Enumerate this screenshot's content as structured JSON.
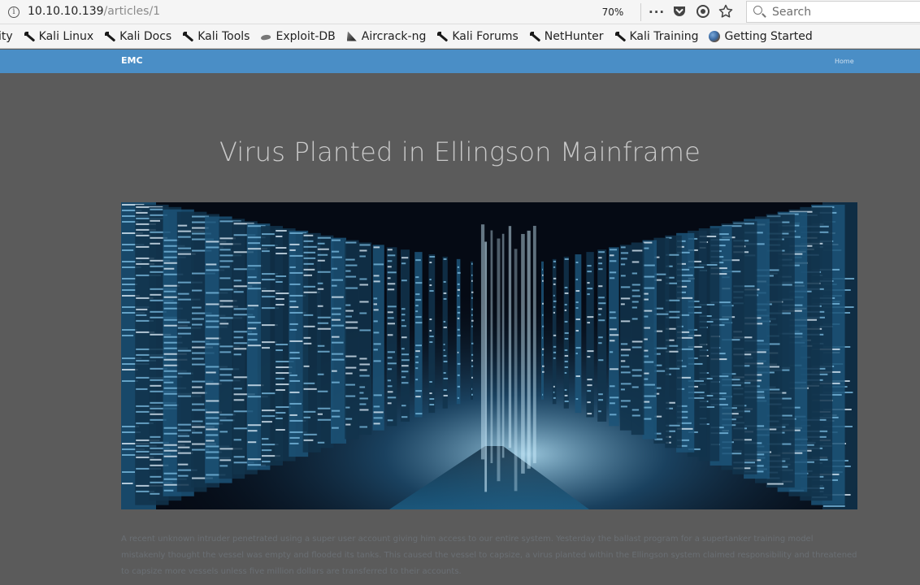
{
  "browser": {
    "url_host": "10.10.10.139",
    "url_path": "/articles/1",
    "zoom": "70%",
    "search_placeholder": "Search",
    "bookmarks": [
      {
        "label": "ity",
        "icon": "none"
      },
      {
        "label": "Kali Linux",
        "icon": "kali-dragon-icon"
      },
      {
        "label": "Kali Docs",
        "icon": "kali-dragon-icon"
      },
      {
        "label": "Kali Tools",
        "icon": "kali-dragon-icon"
      },
      {
        "label": "Exploit-DB",
        "icon": "exploit-db-icon"
      },
      {
        "label": "Aircrack-ng",
        "icon": "aircrack-icon"
      },
      {
        "label": "Kali Forums",
        "icon": "kali-dragon-icon"
      },
      {
        "label": "NetHunter",
        "icon": "kali-dragon-icon"
      },
      {
        "label": "Kali Training",
        "icon": "kali-dragon-icon"
      },
      {
        "label": "Getting Started",
        "icon": "globe-icon"
      }
    ]
  },
  "navbar": {
    "brand": "EMC",
    "home_link": "Home",
    "color": "#4a8ec6"
  },
  "article": {
    "title": "Virus Planted in Ellingson Mainframe",
    "hero_image": "server-corridor-data-image",
    "body": "A recent unknown intruder penetrated using a super user account giving him access to our entire system. Yesterday the ballast program for a supertanker training model mistakenly thought the vessel was empty and flooded its tanks. This caused the vessel to capsize, a virus planted within the Ellingson system claimed responsibility and threatened to capsize more vessels unless five million dollars are transferred to their accounts."
  },
  "colors": {
    "page_background": "#5b5b5b",
    "title_text": "#c9c9c9",
    "body_text": "#6a6f74"
  }
}
